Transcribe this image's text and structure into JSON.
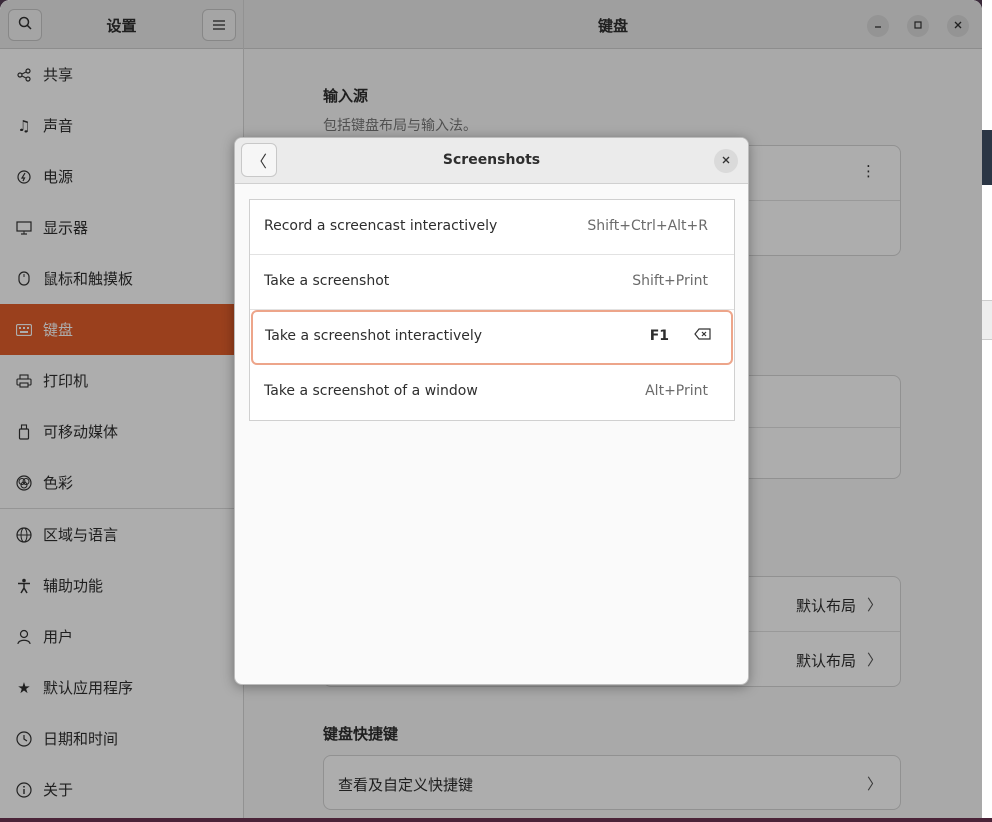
{
  "sidebar": {
    "title": "设置",
    "search_icon": "search-icon",
    "menu_icon": "hamburger-menu-icon",
    "items": [
      {
        "label": "共享",
        "icon": "share-icon"
      },
      {
        "label": "声音",
        "icon": "music-note-icon"
      },
      {
        "label": "电源",
        "icon": "power-icon"
      },
      {
        "label": "显示器",
        "icon": "display-icon"
      },
      {
        "label": "鼠标和触摸板",
        "icon": "mouse-icon"
      },
      {
        "label": "键盘",
        "icon": "keyboard-icon",
        "active": true
      },
      {
        "label": "打印机",
        "icon": "printer-icon"
      },
      {
        "label": "可移动媒体",
        "icon": "removable-media-icon"
      },
      {
        "label": "色彩",
        "icon": "color-icon"
      },
      {
        "label": "区域与语言",
        "icon": "globe-icon"
      },
      {
        "label": "辅助功能",
        "icon": "accessibility-icon"
      },
      {
        "label": "用户",
        "icon": "user-icon"
      },
      {
        "label": "默认应用程序",
        "icon": "star-icon"
      },
      {
        "label": "日期和时间",
        "icon": "clock-icon"
      },
      {
        "label": "关于",
        "icon": "info-icon"
      }
    ]
  },
  "header": {
    "title": "键盘",
    "controls": [
      "minimize",
      "maximize",
      "close"
    ]
  },
  "main": {
    "input_sources_title": "输入源",
    "input_sources_sub": "包括键盘布局与输入法。",
    "layout_rows": [
      {
        "value": "默认布局"
      },
      {
        "value": "默认布局"
      }
    ],
    "shortcuts_title": "键盘快捷键",
    "shortcuts_row": "查看及自定义快捷键"
  },
  "dialog": {
    "title": "Screenshots",
    "rows": [
      {
        "label": "Record a screencast interactively",
        "accel": "Shift+Ctrl+Alt+R"
      },
      {
        "label": "Take a screenshot",
        "accel": "Shift+Print"
      },
      {
        "label": "Take a screenshot interactively",
        "accel": "F1",
        "editing": true
      },
      {
        "label": "Take a screenshot of a window",
        "accel": "Alt+Print"
      }
    ]
  },
  "colors": {
    "accent": "#e35f2c",
    "edit_border": "#eda58a"
  }
}
